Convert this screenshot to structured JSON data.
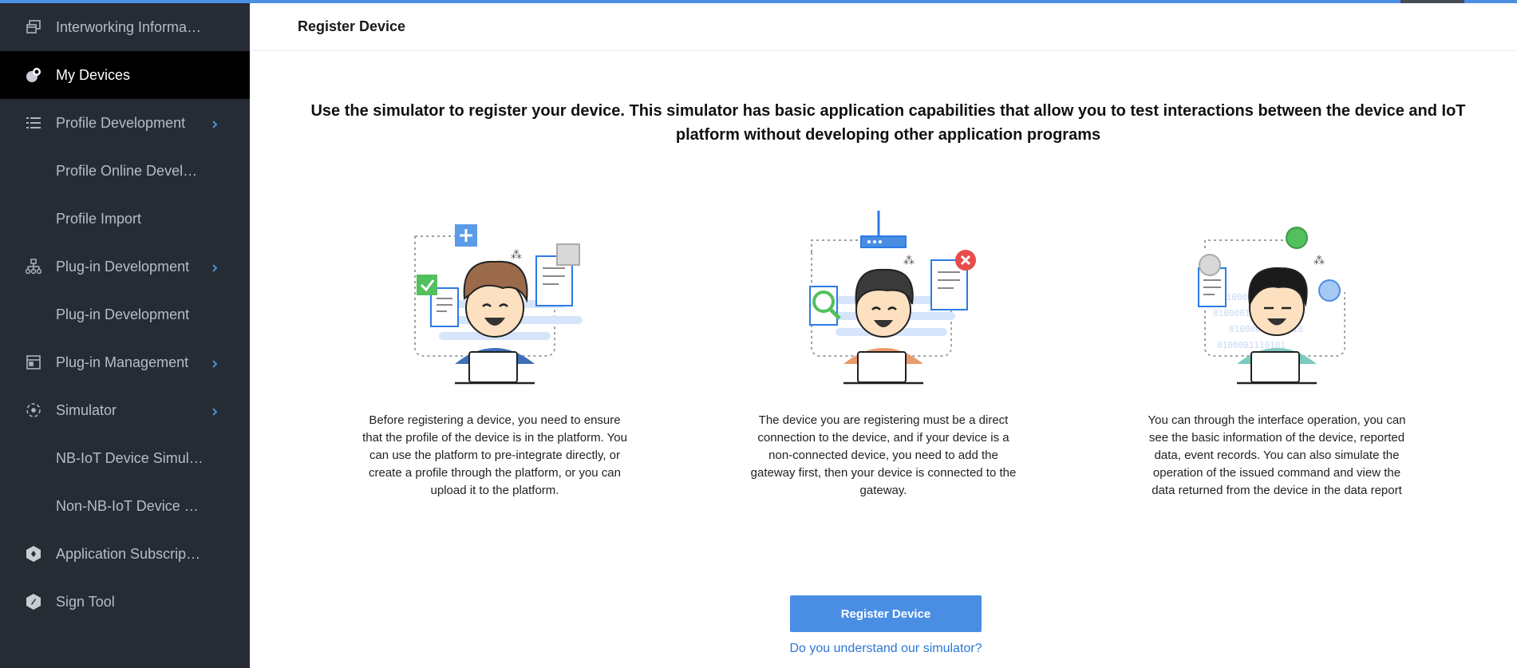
{
  "sidebar": {
    "items": [
      {
        "label": "Interworking Information",
        "icon": "window-icon"
      },
      {
        "label": "My Devices",
        "icon": "devices-icon",
        "active": true
      },
      {
        "label": "Profile Development",
        "icon": "list-icon",
        "chevron": true
      },
      {
        "label": "Profile Online Develop...",
        "sub": true
      },
      {
        "label": "Profile Import",
        "sub": true
      },
      {
        "label": "Plug-in Development",
        "icon": "hierarchy-icon",
        "chevron": true
      },
      {
        "label": "Plug-in Development",
        "sub": true
      },
      {
        "label": "Plug-in Management",
        "icon": "panel-icon",
        "chevron": true
      },
      {
        "label": "Simulator",
        "icon": "simulator-icon",
        "chevron": true
      },
      {
        "label": "NB-IoT Device Simula...",
        "sub": true
      },
      {
        "label": "Non-NB-IoT Device S...",
        "sub": true
      },
      {
        "label": "Application Subscription",
        "icon": "hexagon-icon"
      },
      {
        "label": "Sign Tool",
        "icon": "hexagon-icon"
      }
    ]
  },
  "header": {
    "title": "Register Device"
  },
  "main": {
    "intro": "Use the simulator to register your device. This simulator has basic application capabilities that allow you to test interactions between the device and IoT platform without developing other application programs",
    "steps": [
      {
        "text": "Before registering a device, you need to ensure that the profile of the device is in the platform. You can use the platform to pre-integrate directly, or create a profile through the platform, or you can upload it to the platform."
      },
      {
        "text": "The device you are registering must be a direct connection to the device, and if your device is a non-connected device, you need to add the gateway first, then your device is connected to the gateway."
      },
      {
        "text": "You can through the interface operation, you can see the basic information of the device, reported data, event records. You can also simulate the operation of the issued command and view the data returned from the device in the data report"
      }
    ],
    "register_button": "Register Device",
    "help_link": "Do you understand our simulator?"
  },
  "colors": {
    "accent": "#4a8ee3",
    "sidebar_bg": "#262b34",
    "sidebar_active": "#000000",
    "link": "#2a78d6"
  }
}
